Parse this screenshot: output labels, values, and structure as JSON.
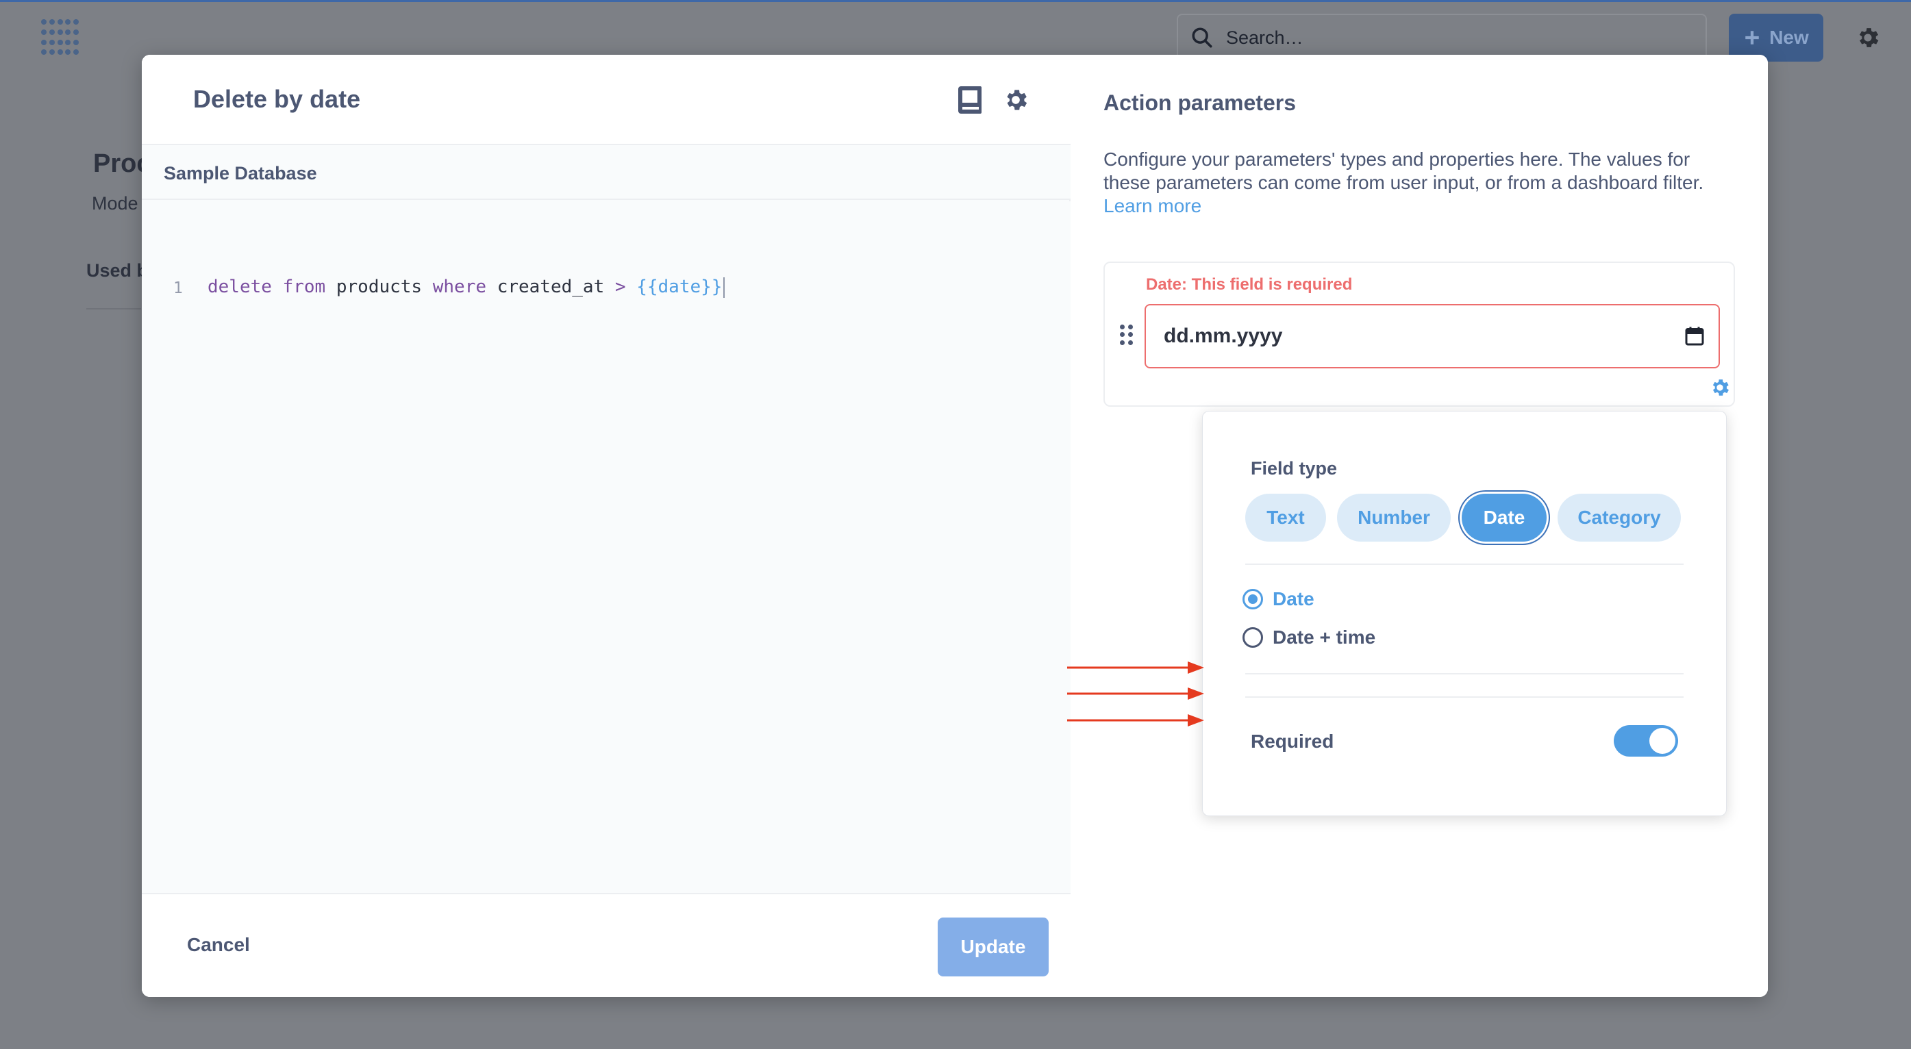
{
  "background": {
    "search_placeholder": "Search…",
    "new_label": "New",
    "page_title": "Proc",
    "page_subtitle": "Mode",
    "used_by_label": "Used b"
  },
  "modal": {
    "title": "Delete by date",
    "database": "Sample Database",
    "code": {
      "line_number": "1",
      "tokens": [
        "delete",
        "from",
        "products",
        "where",
        "created_at",
        ">",
        "{{date}}"
      ]
    },
    "cancel_label": "Cancel",
    "update_label": "Update"
  },
  "params": {
    "title": "Action parameters",
    "description": "Configure your parameters' types and properties here. The values for these parameters can come from user input, or from a dashboard filter.",
    "learn_more": "Learn more",
    "error_label": "Date: This field is required",
    "date_placeholder": "dd.mm.yyyy"
  },
  "popover": {
    "field_type_label": "Field type",
    "field_types": [
      "Text",
      "Number",
      "Date",
      "Category"
    ],
    "selected_field_type": "Date",
    "date_options": [
      "Date",
      "Date + time"
    ],
    "selected_date_option": "Date",
    "required_label": "Required",
    "required_on": true
  },
  "colors": {
    "accent": "#509ee3",
    "error": "#ed6e6e",
    "annotation_arrow": "#e53a1f"
  },
  "icons": [
    "logo-icon",
    "search-icon",
    "plus-icon",
    "gear-icon",
    "reference-book-icon",
    "drag-handle-icon",
    "calendar-icon"
  ]
}
